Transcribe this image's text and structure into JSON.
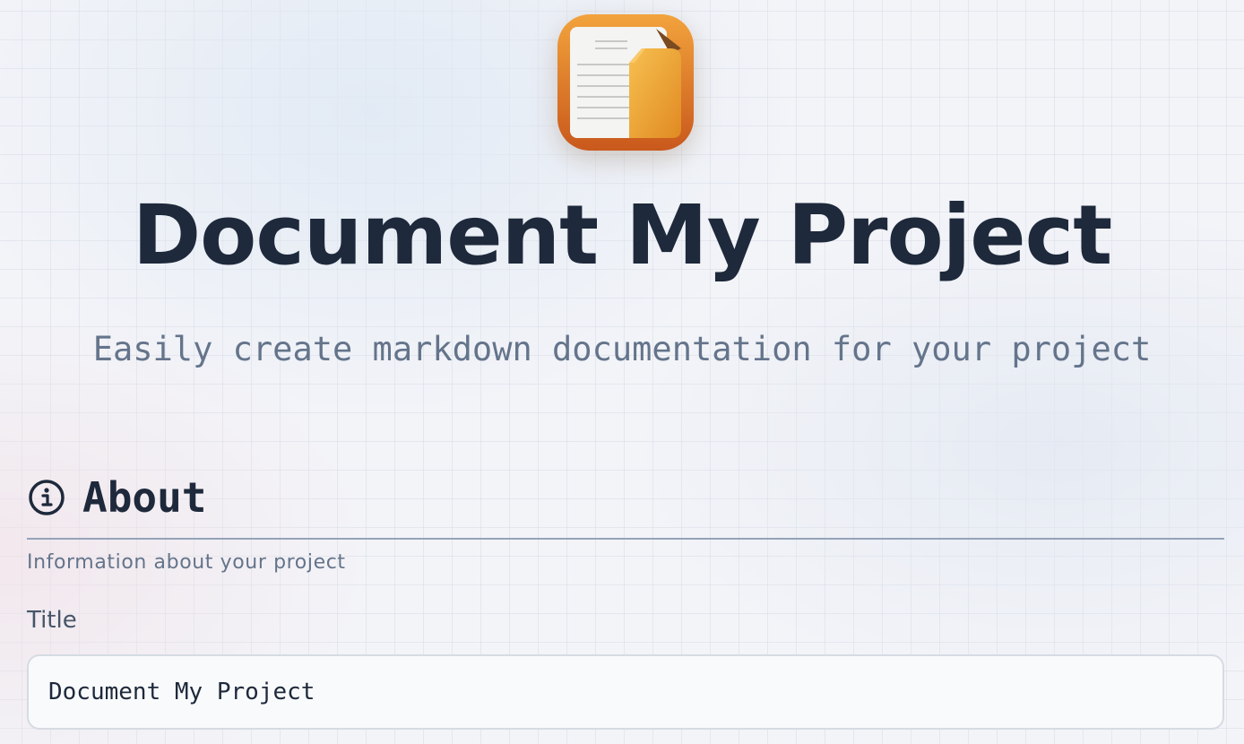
{
  "header": {
    "app_icon": "document-folder-icon",
    "title": "Document My Project",
    "subtitle": "Easily create markdown documentation for your project"
  },
  "about_section": {
    "icon": "info-icon",
    "title": "About",
    "description": "Information about your project",
    "fields": {
      "title": {
        "label": "Title",
        "value": "Document My Project"
      }
    }
  },
  "colors": {
    "title_text": "#1e293b",
    "muted_text": "#64748b",
    "icon_orange": "#e8902a",
    "divider": "#94a3b8"
  }
}
